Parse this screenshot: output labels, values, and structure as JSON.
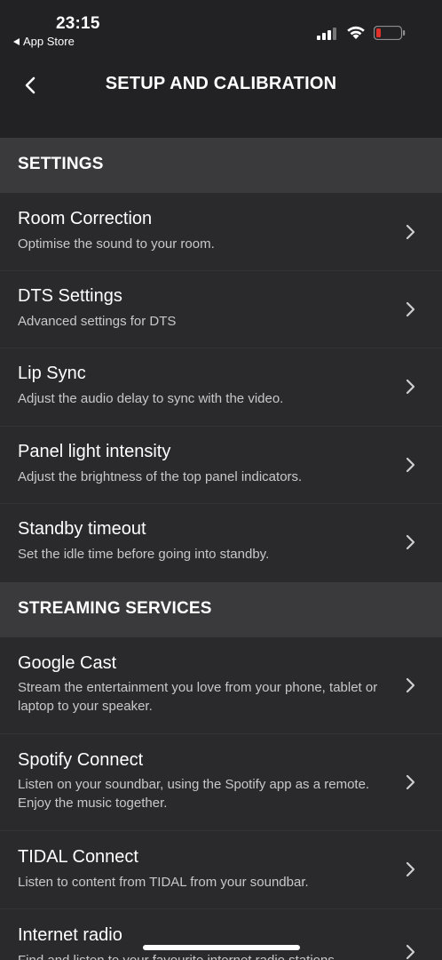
{
  "status_bar": {
    "time": "23:15",
    "back_app": "App Store"
  },
  "header": {
    "title": "SETUP AND CALIBRATION"
  },
  "sections": [
    {
      "header": "SETTINGS",
      "items": [
        {
          "title": "Room Correction",
          "subtitle": "Optimise the sound to your room."
        },
        {
          "title": "DTS Settings",
          "subtitle": "Advanced settings for DTS"
        },
        {
          "title": "Lip Sync",
          "subtitle": "Adjust the audio delay to sync with the video."
        },
        {
          "title": "Panel light intensity",
          "subtitle": "Adjust the brightness of the top panel indicators."
        },
        {
          "title": "Standby timeout",
          "subtitle": "Set the idle time before going into standby."
        }
      ]
    },
    {
      "header": "STREAMING SERVICES",
      "items": [
        {
          "title": "Google Cast",
          "subtitle": "Stream the entertainment you love from your phone, tablet or laptop to your speaker."
        },
        {
          "title": "Spotify Connect",
          "subtitle": "Listen on your soundbar, using the Spotify app as a remote. Enjoy the music together."
        },
        {
          "title": "TIDAL Connect",
          "subtitle": "Listen to content from TIDAL from your soundbar."
        },
        {
          "title": "Internet radio",
          "subtitle": "Find and listen to your favourite internet radio stations."
        }
      ]
    }
  ],
  "colors": {
    "background": "#2a2a2c",
    "section_header": "#3a3a3c",
    "top_bar": "#222224",
    "battery_low": "#e0302a"
  }
}
